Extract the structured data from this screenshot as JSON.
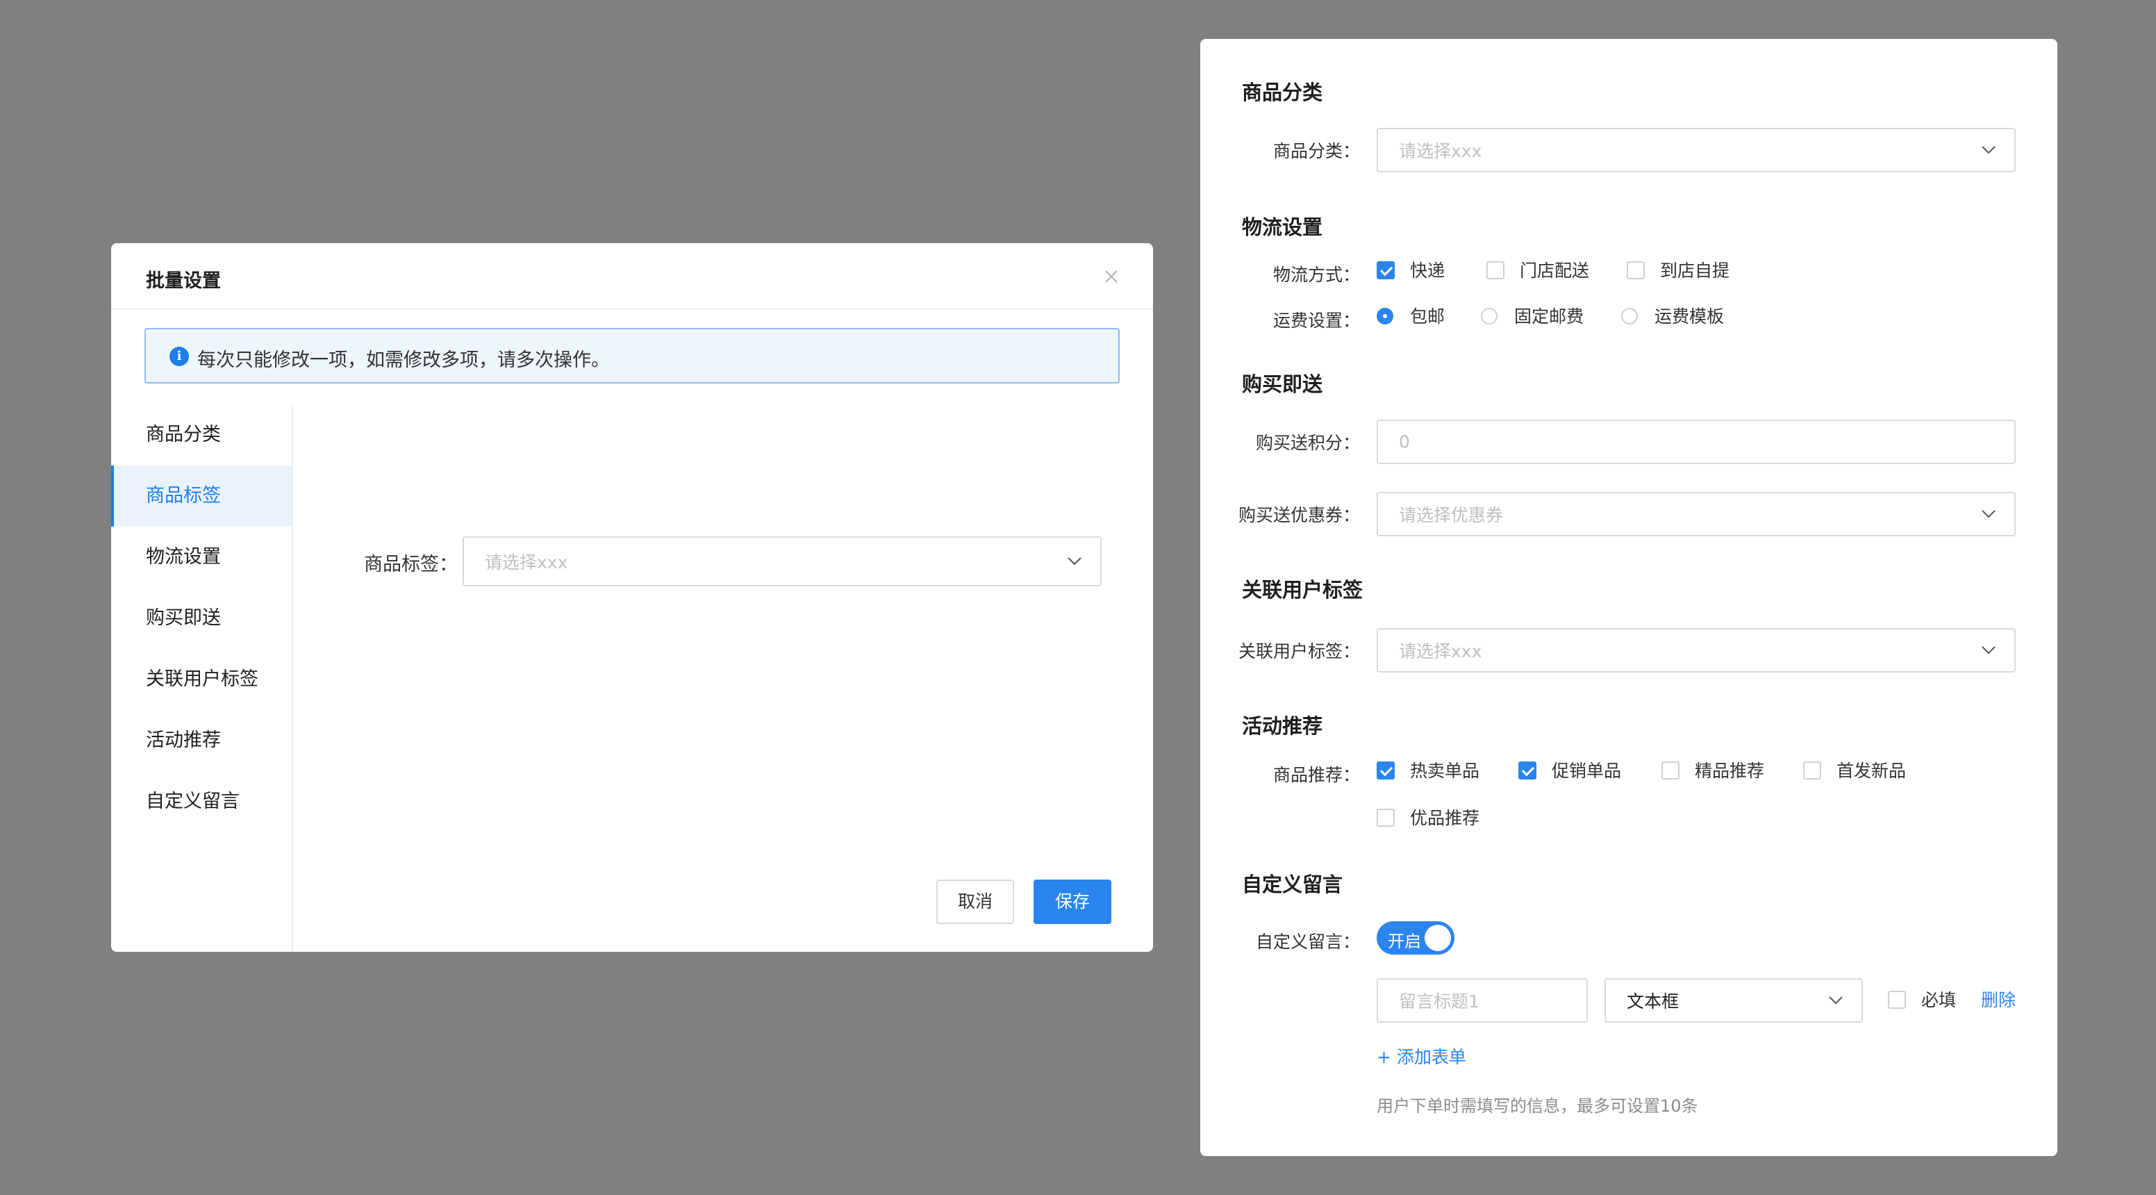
{
  "modal": {
    "title": "批量设置",
    "alert": "每次只能修改一项，如需修改多项，请多次操作。",
    "nav": [
      "商品分类",
      "商品标签",
      "物流设置",
      "购买即送",
      "关联用户标签",
      "活动推荐",
      "自定义留言"
    ],
    "active_nav": "商品标签",
    "field_label": "商品标签：",
    "field_placeholder": "请选择xxx",
    "cancel": "取消",
    "save": "保存"
  },
  "panel": {
    "category": {
      "title": "商品分类",
      "label": "商品分类：",
      "placeholder": "请选择xxx"
    },
    "logistics": {
      "title": "物流设置",
      "method_label": "物流方式：",
      "methods": [
        {
          "label": "快递",
          "checked": true
        },
        {
          "label": "门店配送",
          "checked": false
        },
        {
          "label": "到店自提",
          "checked": false
        }
      ],
      "fee_label": "运费设置：",
      "fees": [
        {
          "label": "包邮",
          "selected": true
        },
        {
          "label": "固定邮费",
          "selected": false
        },
        {
          "label": "运费模板",
          "selected": false
        }
      ]
    },
    "gift": {
      "title": "购买即送",
      "points_label": "购买送积分：",
      "points_placeholder": "0",
      "coupon_label": "购买送优惠券：",
      "coupon_placeholder": "请选择优惠券"
    },
    "user_tag": {
      "title": "关联用户标签",
      "label": "关联用户标签：",
      "placeholder": "请选择xxx"
    },
    "promo": {
      "title": "活动推荐",
      "label": "商品推荐：",
      "options": [
        {
          "label": "热卖单品",
          "checked": true
        },
        {
          "label": "促销单品",
          "checked": true
        },
        {
          "label": "精品推荐",
          "checked": false
        },
        {
          "label": "首发新品",
          "checked": false
        },
        {
          "label": "优品推荐",
          "checked": false
        }
      ]
    },
    "message": {
      "title": "自定义留言",
      "label": "自定义留言：",
      "switch_label": "开启",
      "switch_on": true,
      "title_placeholder": "留言标题1",
      "type_value": "文本框",
      "required_label": "必填",
      "required_checked": false,
      "delete_label": "删除",
      "add_label": "+ 添加表单",
      "hint": "用户下单时需填写的信息，最多可设置10条"
    }
  },
  "colors": {
    "background": "#808080",
    "accent": "#2b85ee",
    "alert_bg": "#eef5fd"
  }
}
